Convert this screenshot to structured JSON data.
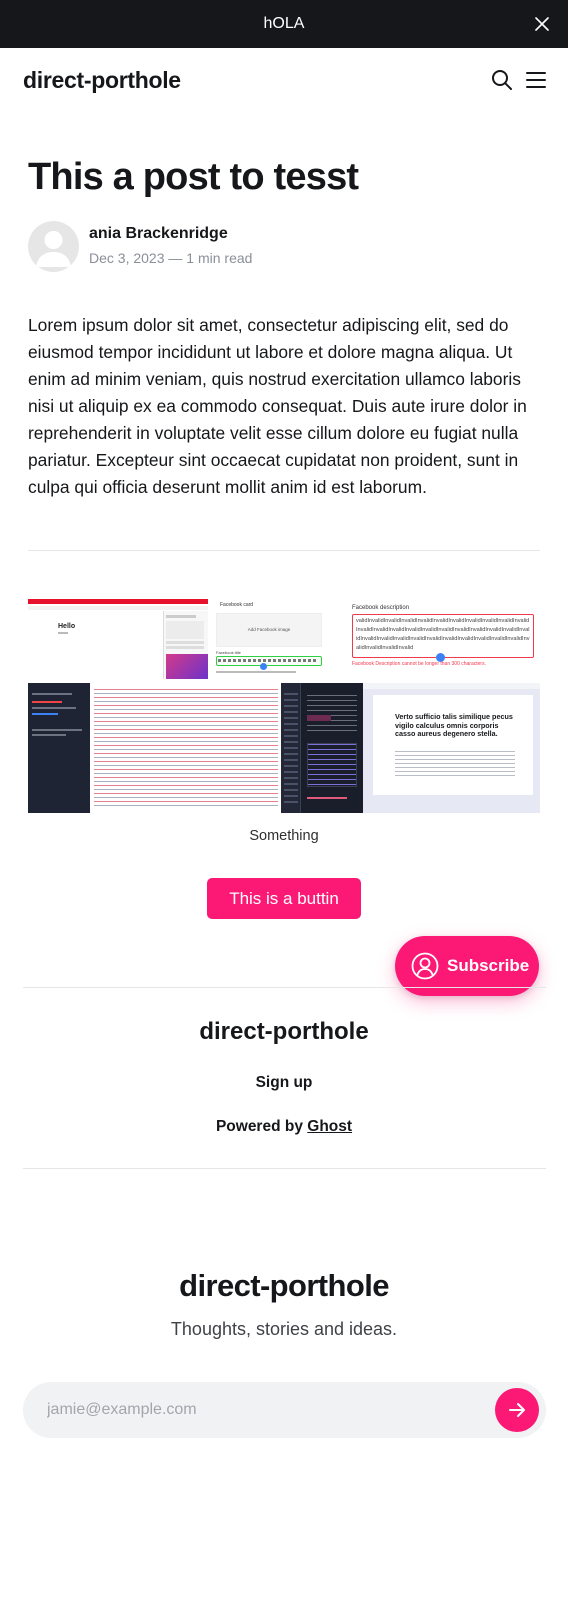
{
  "announcement": {
    "text": "hOLA",
    "close_icon": "close-icon"
  },
  "header": {
    "site_title": "direct-porthole",
    "search_icon": "search-icon",
    "menu_icon": "menu-icon"
  },
  "post": {
    "title": "This a post to tesst",
    "author": "ania Brackenridge",
    "date": "Dec 3, 2023",
    "separator": "—",
    "read_time": "1 min read",
    "body": "Lorem ipsum dolor sit amet, consectetur adipiscing elit, sed do eiusmod tempor incididunt ut labore et dolore magna aliqua. Ut enim ad minim veniam, quis nostrud exercitation ullamco laboris nisi ut aliquip ex ea commodo consequat. Duis aute irure dolor in reprehenderit in voluptate velit esse cillum dolore eu fugiat nulla pariatur. Excepteur sint occaecat cupidatat non proident, sunt in culpa qui officia deserunt mollit anim id est laborum."
  },
  "gallery": {
    "caption": "Something",
    "images": [
      {
        "kind": "hello-page-screenshot",
        "text": "Hello"
      },
      {
        "kind": "facebook-card-screenshot",
        "heading": "Facebook card",
        "placeholder": "Add Facebook image",
        "field_label": "Facebook title"
      },
      {
        "kind": "facebook-description-screenshot",
        "heading": "Facebook description",
        "value": "validInvalidInvalidInvalidInvalidInvalidInvalidInvalidInvalidInvalidInvalidInvalidInvalidInvalidInvalidInvalidInvalidInvalidInvalidInvalidInvalidInvalidInvalidInvalidInvalidInvalidInvalidInvalidInvalidInvalidInvalidInvalidInvalidInvalidInvalidInvalid",
        "error": "Facebook Description cannot be longer than 300 characters."
      },
      {
        "kind": "code-editor-screenshot"
      },
      {
        "kind": "dark-editor-screenshot"
      },
      {
        "kind": "article-preview-screenshot",
        "title": "Verto sufficio talis similique pecus vigilo calculus omnis corporis casso aureus degenero stella."
      }
    ]
  },
  "button": {
    "label": "This is a buttin"
  },
  "subscribe_fab": {
    "label": "Subscribe",
    "icon": "user-circle-icon"
  },
  "footer": {
    "site_title": "direct-porthole",
    "signup": "Sign up",
    "powered_prefix": "Powered by",
    "powered_link": "Ghost"
  },
  "cta": {
    "title": "direct-porthole",
    "description": "Thoughts, stories and ideas.",
    "email_placeholder": "jamie@example.com",
    "submit_icon": "arrow-right-icon"
  },
  "colors": {
    "accent": "#fb1975",
    "dark": "#15171a",
    "muted": "#8a8f98"
  }
}
